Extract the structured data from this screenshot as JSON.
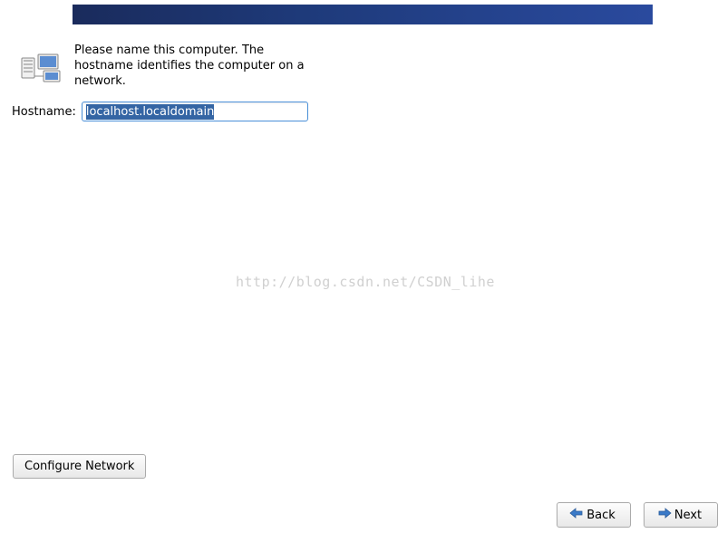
{
  "banner": {},
  "description": "Please name this computer.  The hostname identifies the computer on a network.",
  "hostname": {
    "label": "Hostname:",
    "value": "localhost.localdomain"
  },
  "configure_network_label": "Configure Network",
  "nav": {
    "back_label": "Back",
    "next_label": "Next"
  },
  "watermark": "http://blog.csdn.net/CSDN_lihe"
}
